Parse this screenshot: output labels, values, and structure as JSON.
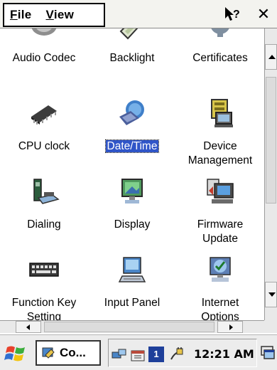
{
  "menu": {
    "file_first": "F",
    "file_rest": "ile",
    "view_first": "V",
    "view_rest": "iew"
  },
  "applets": [
    {
      "label": "Audio Codec",
      "icon": "speaker-icon"
    },
    {
      "label": "Backlight",
      "icon": "backlight-icon"
    },
    {
      "label": "Certificates",
      "icon": "gear-icon"
    },
    {
      "label": "CPU clock",
      "icon": "chip-icon"
    },
    {
      "label": "Date/Time",
      "icon": "globe-clock-icon",
      "selected": true
    },
    {
      "label": "Device",
      "label2": "Management",
      "icon": "device-management-icon"
    },
    {
      "label": "Dialing",
      "icon": "phone-icon"
    },
    {
      "label": "Display",
      "icon": "display-icon"
    },
    {
      "label": "Firmware",
      "label2": "Update",
      "icon": "firmware-update-icon"
    },
    {
      "label": "Function Key",
      "label2": "Setting",
      "icon": "keyboard-icon"
    },
    {
      "label": "Input Panel",
      "icon": "input-panel-icon"
    },
    {
      "label": "Internet",
      "label2": "Options",
      "icon": "internet-options-icon"
    }
  ],
  "taskbar": {
    "task_label": "Co...",
    "clock": "12:21 AM",
    "tray_badge": "1"
  },
  "colors": {
    "selection": "#2f55c8",
    "taskbar": "#ececec"
  }
}
